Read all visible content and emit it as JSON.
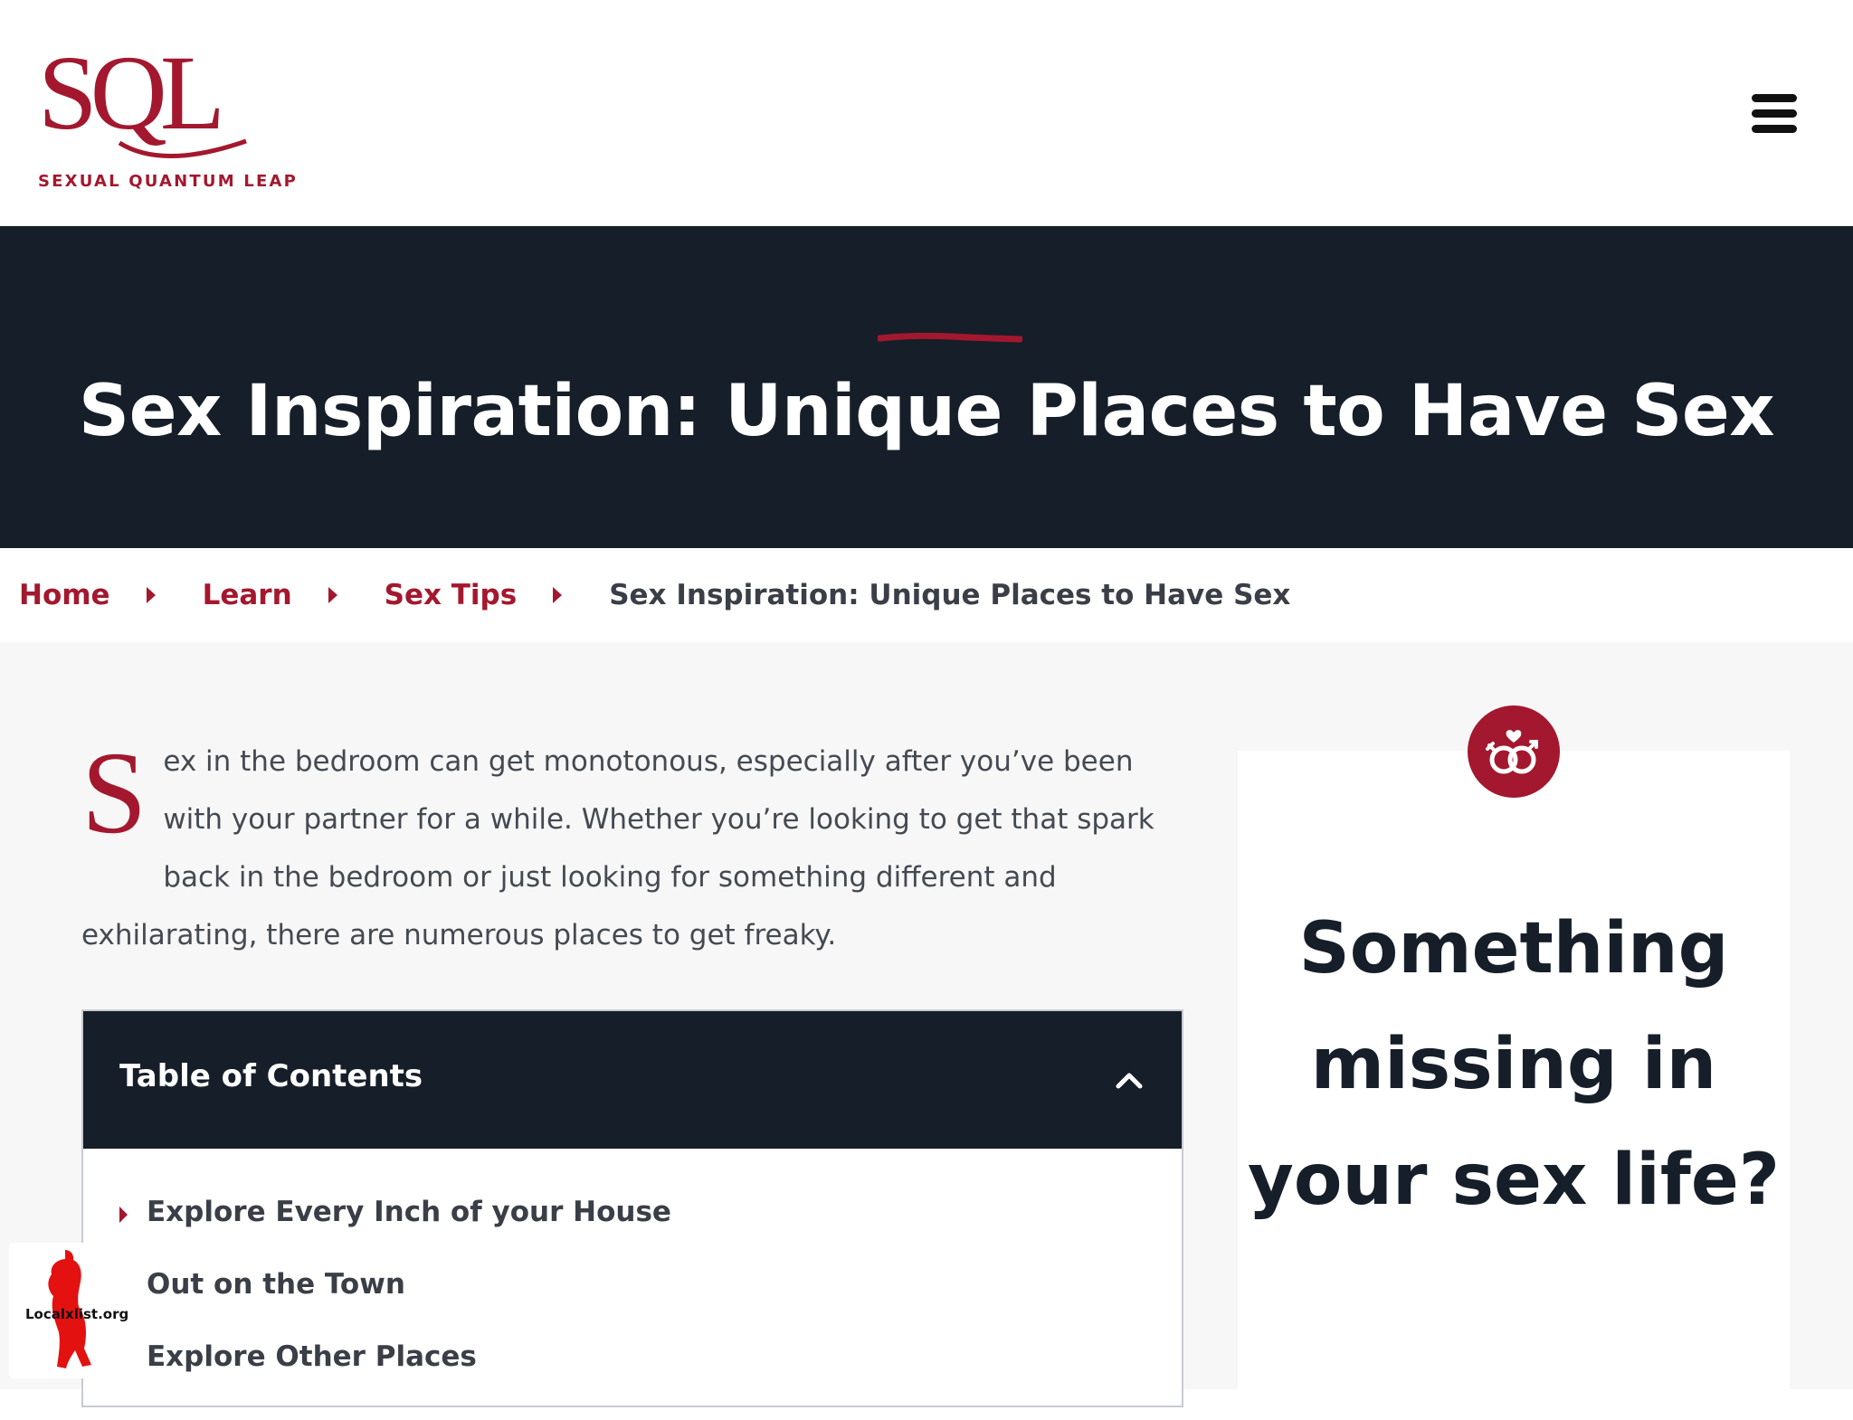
{
  "header": {
    "logo_letters": "SQL",
    "logo_tagline": "SEXUAL QUANTUM LEAP",
    "menu_icon": "hamburger-icon"
  },
  "hero": {
    "title": "Sex Inspiration: Unique Places to Have Sex"
  },
  "breadcrumb": {
    "items": [
      "Home",
      "Learn",
      "Sex Tips"
    ],
    "current": "Sex Inspiration: Unique Places to Have Sex",
    "separator_icon": "caret-right-icon"
  },
  "article": {
    "drop_cap": "S",
    "intro_rest": "ex in the bedroom can get monotonous, especially after you’ve been with your partner for a while. Whether you’re looking to get that spark back in the bedroom or just looking for something different and exhilarating, there are numerous places to get freaky."
  },
  "toc": {
    "title": "Table of Contents",
    "toggle_icon": "chevron-up-icon",
    "items": [
      "Explore Every Inch of your House",
      "Out on the Town",
      "Explore Other Places"
    ]
  },
  "sidebar": {
    "icon": "linked-gender-rings-icon",
    "heading": "Something missing in your sex life?"
  },
  "watermark": {
    "text": "Localxlist.org"
  },
  "colors": {
    "brand_red": "#a3182e",
    "dark_navy": "#161e29",
    "body_text": "#444a52",
    "background_light": "#f7f7f7"
  }
}
